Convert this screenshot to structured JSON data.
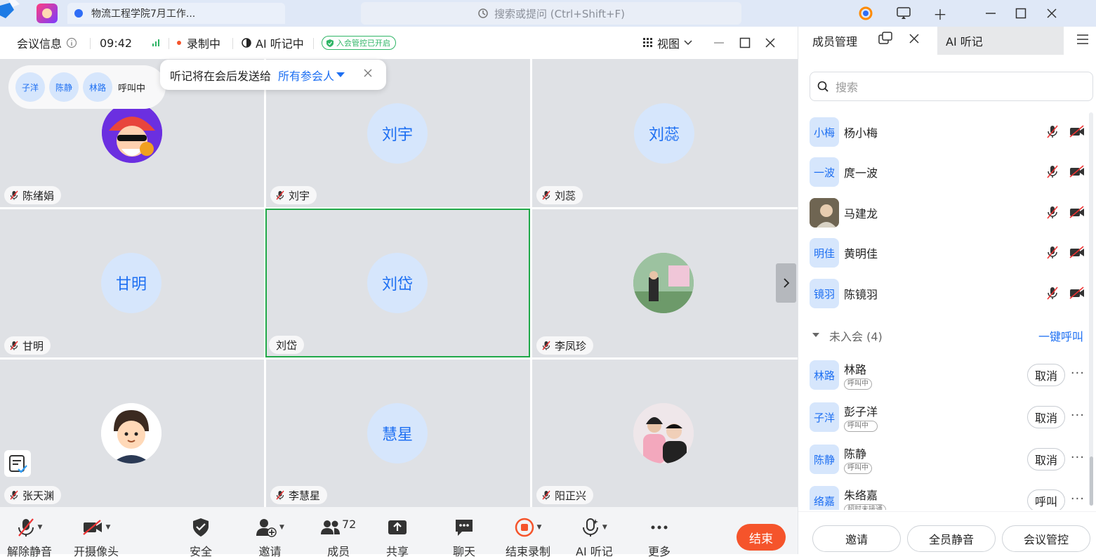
{
  "browser": {
    "tab_title": "物流工程学院7月工作...",
    "search_placeholder": "搜索或提问 (Ctrl+Shift+F)"
  },
  "meeting_bar": {
    "info_label": "会议信息",
    "time": "09:42",
    "recording": "录制中",
    "ai_listening": "AI 听记中",
    "admission_badge": "入会管控已开启",
    "view_label": "视图"
  },
  "toast": {
    "text": "听记将在会后发送给",
    "recipients": "所有参会人"
  },
  "calling": {
    "avatars": [
      "子洋",
      "陈静",
      "林路"
    ],
    "status": "呼叫中"
  },
  "tiles": [
    {
      "name": "陈绪娟",
      "avatar_text": "",
      "avatar_kind": "cartoon-santa"
    },
    {
      "name": "刘宇",
      "avatar_text": "刘宇"
    },
    {
      "name": "刘蕊",
      "avatar_text": "刘蕊"
    },
    {
      "name": "甘明",
      "avatar_text": "甘明"
    },
    {
      "name": "刘岱",
      "avatar_text": "刘岱"
    },
    {
      "name": "李凤珍",
      "avatar_text": "",
      "avatar_kind": "photo-outdoor"
    },
    {
      "name": "张天渊",
      "avatar_text": "",
      "avatar_kind": "cartoon-boy"
    },
    {
      "name": "李慧星",
      "avatar_text": "慧星"
    },
    {
      "name": "阳正兴",
      "avatar_text": "",
      "avatar_kind": "photo-pair"
    }
  ],
  "toolbar": {
    "unmute": "解除静音",
    "camera": "开摄像头",
    "security": "安全",
    "invite": "邀请",
    "members": "成员",
    "member_count": "72",
    "share": "共享",
    "chat": "聊天",
    "stop_recording": "结束录制",
    "ai_notes": "AI 听记",
    "more": "更多",
    "end": "结束"
  },
  "panel": {
    "tab_members": "成员管理",
    "tab_ai": "AI 听记",
    "search_placeholder": "搜索",
    "members": [
      {
        "avatar": "小梅",
        "name": "杨小梅"
      },
      {
        "avatar": "一波",
        "name": "庹一波"
      },
      {
        "avatar": "",
        "name": "马建龙"
      },
      {
        "avatar": "明佳",
        "name": "黄明佳"
      },
      {
        "avatar": "镜羽",
        "name": "陈镜羽"
      }
    ],
    "not_joined_label": "未入会 (4)",
    "call_all": "一键呼叫",
    "not_joined": [
      {
        "avatar": "林路",
        "name": "林路",
        "status": "呼叫中",
        "action": "取消"
      },
      {
        "avatar": "子洋",
        "name": "彭子洋",
        "status": "呼叫中",
        "action": "取消"
      },
      {
        "avatar": "陈静",
        "name": "陈静",
        "status": "呼叫中",
        "action": "取消"
      },
      {
        "avatar": "络嘉",
        "name": "朱络嘉",
        "status": "超时未接通",
        "action": "呼叫"
      }
    ],
    "invite": "邀请",
    "mute_all": "全员静音",
    "control": "会议管控"
  },
  "colors": {
    "accent": "#1d6ff2",
    "end": "#f5542b",
    "active_border": "#1fa848",
    "green": "#2fb566"
  }
}
